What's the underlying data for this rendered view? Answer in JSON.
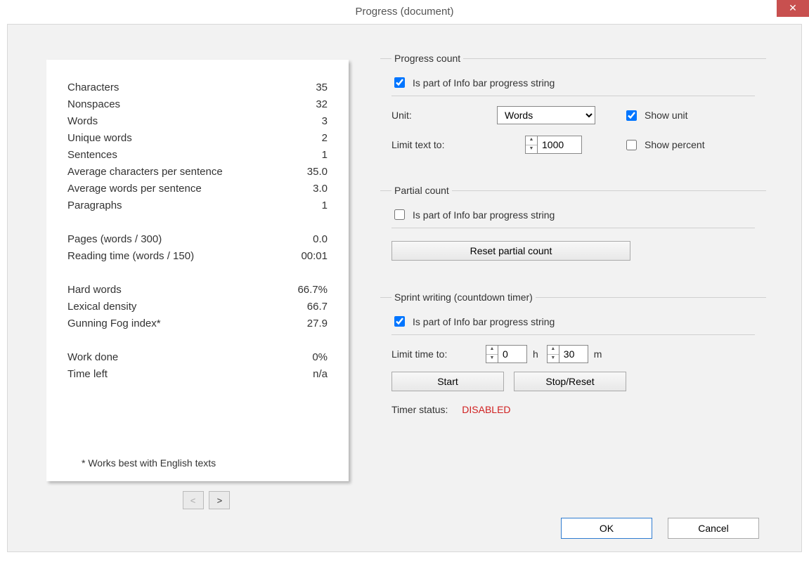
{
  "window": {
    "title": "Progress (document)",
    "close_glyph": "✕"
  },
  "stats": {
    "rows": [
      {
        "label": "Characters",
        "value": "35"
      },
      {
        "label": "Nonspaces",
        "value": "32"
      },
      {
        "label": "Words",
        "value": "3"
      },
      {
        "label": "Unique words",
        "value": "2"
      },
      {
        "label": "Sentences",
        "value": "1"
      },
      {
        "label": "Average characters per sentence",
        "value": "35.0"
      },
      {
        "label": "Average words per sentence",
        "value": "3.0"
      },
      {
        "label": "Paragraphs",
        "value": "1"
      }
    ],
    "rows2": [
      {
        "label": "Pages (words / 300)",
        "value": "0.0"
      },
      {
        "label": "Reading time (words / 150)",
        "value": "00:01"
      }
    ],
    "rows3": [
      {
        "label": "Hard words",
        "value": "66.7%"
      },
      {
        "label": "Lexical density",
        "value": "66.7"
      },
      {
        "label": "Gunning Fog index*",
        "value": "27.9"
      }
    ],
    "rows4": [
      {
        "label": "Work done",
        "value": "0%"
      },
      {
        "label": "Time left",
        "value": "n/a"
      }
    ],
    "footnote": "* Works best with English texts",
    "pager_prev": "<",
    "pager_next": ">"
  },
  "progress_count": {
    "legend": "Progress count",
    "is_part_label": "Is part of Info bar progress string",
    "is_part_checked": true,
    "unit_label": "Unit:",
    "unit_value": "Words",
    "show_unit_label": "Show unit",
    "show_unit_checked": true,
    "limit_label": "Limit text to:",
    "limit_value": "1000",
    "show_percent_label": "Show percent",
    "show_percent_checked": false
  },
  "partial_count": {
    "legend": "Partial count",
    "is_part_label": "Is part of Info bar progress string",
    "is_part_checked": false,
    "reset_label": "Reset partial count"
  },
  "sprint": {
    "legend": "Sprint writing (countdown timer)",
    "is_part_label": "Is part of Info bar progress string",
    "is_part_checked": true,
    "limit_time_label": "Limit time to:",
    "hours_value": "0",
    "hours_suffix": "h",
    "minutes_value": "30",
    "minutes_suffix": "m",
    "start_label": "Start",
    "stop_label": "Stop/Reset",
    "status_label": "Timer status:",
    "status_value": "DISABLED"
  },
  "buttons": {
    "ok": "OK",
    "cancel": "Cancel"
  }
}
